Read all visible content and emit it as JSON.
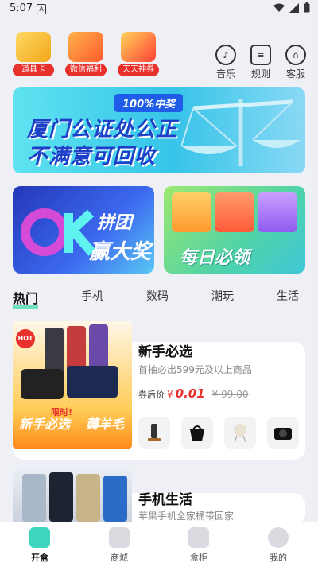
{
  "status": {
    "time": "5:07",
    "notif_glyph": "A"
  },
  "top_icons": [
    {
      "label": "道具卡",
      "color": "#f7b32b"
    },
    {
      "label": "微信福利",
      "color": "#ff6b3d"
    },
    {
      "label": "天天神券",
      "color": "#ff4b4b"
    }
  ],
  "right_nav": [
    {
      "label": "音乐",
      "icon": "music-icon"
    },
    {
      "label": "规则",
      "icon": "rules-icon"
    },
    {
      "label": "客服",
      "icon": "headset-icon"
    }
  ],
  "banner": {
    "badge": "100%中奖",
    "line1": "厦门公证处公正",
    "line2": "不满意可回收"
  },
  "promos": [
    {
      "line1": "拼团",
      "line2": "赢大奖"
    },
    {
      "line1": "每日必领"
    }
  ],
  "tabs": [
    "热门",
    "手机",
    "数码",
    "潮玩",
    "生活"
  ],
  "product1": {
    "title": "新手必选",
    "subtitle": "首抽必出599元及以上商品",
    "price_label": "券后价",
    "currency": "¥",
    "price": "0.01",
    "original": "¥ 99.00",
    "hot": "HOT",
    "img_text1": "新手必选",
    "img_text2": "限时!",
    "img_text3": "薅羊毛"
  },
  "product2": {
    "title": "手机生活",
    "subtitle": "苹果手机全家桶带回家"
  },
  "bottom_nav": [
    "开盒",
    "商城",
    "盒柜",
    "我的"
  ]
}
